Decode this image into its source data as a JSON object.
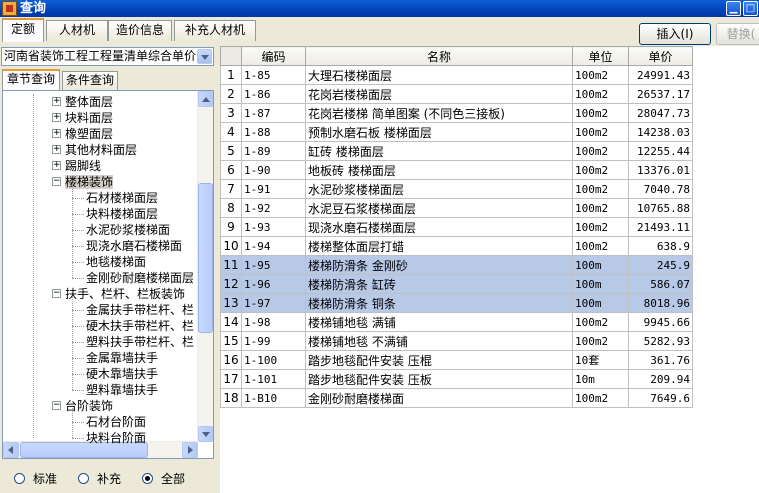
{
  "window": {
    "title": "查询"
  },
  "top_tabs": [
    "定额",
    "人材机",
    "造价信息",
    "补充人材机"
  ],
  "buttons": {
    "insert": "插入(I)",
    "replace": "替换("
  },
  "left": {
    "combo_value": "河南省装饰工程工程量清单综合单价",
    "sub_tabs": [
      "章节查询",
      "条件查询"
    ],
    "tree": [
      {
        "label": "整体面层",
        "level": 1,
        "expander": "+"
      },
      {
        "label": "块料面层",
        "level": 1,
        "expander": "+"
      },
      {
        "label": "橡塑面层",
        "level": 1,
        "expander": "+"
      },
      {
        "label": "其他材料面层",
        "level": 1,
        "expander": "+"
      },
      {
        "label": "踢脚线",
        "level": 1,
        "expander": "+"
      },
      {
        "label": "楼梯装饰",
        "level": 1,
        "expander": "−"
      },
      {
        "label": "石材楼梯面层",
        "level": 2
      },
      {
        "label": "块料楼梯面层",
        "level": 2
      },
      {
        "label": "水泥砂浆楼梯面",
        "level": 2
      },
      {
        "label": "现浇水磨石楼梯面",
        "level": 2
      },
      {
        "label": "地毯楼梯面",
        "level": 2
      },
      {
        "label": "金刚砂耐磨楼梯面层",
        "level": 2
      },
      {
        "label": "扶手、栏杆、栏板装饰",
        "level": 1,
        "expander": "−"
      },
      {
        "label": "金属扶手带栏杆、栏",
        "level": 2
      },
      {
        "label": "硬木扶手带栏杆、栏",
        "level": 2
      },
      {
        "label": "塑料扶手带栏杆、栏",
        "level": 2
      },
      {
        "label": "金属靠墙扶手",
        "level": 2
      },
      {
        "label": "硬木靠墙扶手",
        "level": 2
      },
      {
        "label": "塑料靠墙扶手",
        "level": 2
      },
      {
        "label": "台阶装饰",
        "level": 1,
        "expander": "−"
      },
      {
        "label": "石材台阶面",
        "level": 2
      },
      {
        "label": "块料台阶面",
        "level": 2
      }
    ],
    "radios": [
      {
        "label": "标准",
        "checked": false
      },
      {
        "label": "补充",
        "checked": false
      },
      {
        "label": "全部",
        "checked": true
      }
    ]
  },
  "grid": {
    "columns": [
      "编码",
      "名称",
      "单位",
      "单价"
    ],
    "rows": [
      {
        "n": "1",
        "code": "1-85",
        "name": "大理石楼梯面层",
        "unit": "100m2",
        "price": "24991.43"
      },
      {
        "n": "2",
        "code": "1-86",
        "name": "花岗岩楼梯面层",
        "unit": "100m2",
        "price": "26537.17"
      },
      {
        "n": "3",
        "code": "1-87",
        "name": "花岗岩楼梯 简单图案 (不同色三接板)",
        "unit": "100m2",
        "price": "28047.73"
      },
      {
        "n": "4",
        "code": "1-88",
        "name": "预制水磨石板 楼梯面层",
        "unit": "100m2",
        "price": "14238.03"
      },
      {
        "n": "5",
        "code": "1-89",
        "name": "缸砖 楼梯面层",
        "unit": "100m2",
        "price": "12255.44"
      },
      {
        "n": "6",
        "code": "1-90",
        "name": "地板砖 楼梯面层",
        "unit": "100m2",
        "price": "13376.01"
      },
      {
        "n": "7",
        "code": "1-91",
        "name": "水泥砂浆楼梯面层",
        "unit": "100m2",
        "price": "7040.78"
      },
      {
        "n": "8",
        "code": "1-92",
        "name": "水泥豆石浆楼梯面层",
        "unit": "100m2",
        "price": "10765.88"
      },
      {
        "n": "9",
        "code": "1-93",
        "name": "现浇水磨石楼梯面层",
        "unit": "100m2",
        "price": "21493.11"
      },
      {
        "n": "10",
        "code": "1-94",
        "name": "楼梯整体面层打蜡",
        "unit": "100m2",
        "price": "638.9"
      },
      {
        "n": "11",
        "code": "1-95",
        "name": "楼梯防滑条 金刚砂",
        "unit": "100m",
        "price": "245.9",
        "hl": true
      },
      {
        "n": "12",
        "code": "1-96",
        "name": "楼梯防滑条 缸砖",
        "unit": "100m",
        "price": "586.07",
        "hl": true
      },
      {
        "n": "13",
        "code": "1-97",
        "name": "楼梯防滑条 铜条",
        "unit": "100m",
        "price": "8018.96",
        "hl": true
      },
      {
        "n": "14",
        "code": "1-98",
        "name": "楼梯铺地毯 满铺",
        "unit": "100m2",
        "price": "9945.66"
      },
      {
        "n": "15",
        "code": "1-99",
        "name": "楼梯铺地毯 不满铺",
        "unit": "100m2",
        "price": "5282.93"
      },
      {
        "n": "16",
        "code": "1-100",
        "name": "踏步地毯配件安装 压棍",
        "unit": "10套",
        "price": "361.76"
      },
      {
        "n": "17",
        "code": "1-101",
        "name": "踏步地毯配件安装 压板",
        "unit": "10m",
        "price": "209.94"
      },
      {
        "n": "18",
        "code": "1-B10",
        "name": "金刚砂耐磨楼梯面",
        "unit": "100m2",
        "price": "7649.6"
      }
    ]
  }
}
